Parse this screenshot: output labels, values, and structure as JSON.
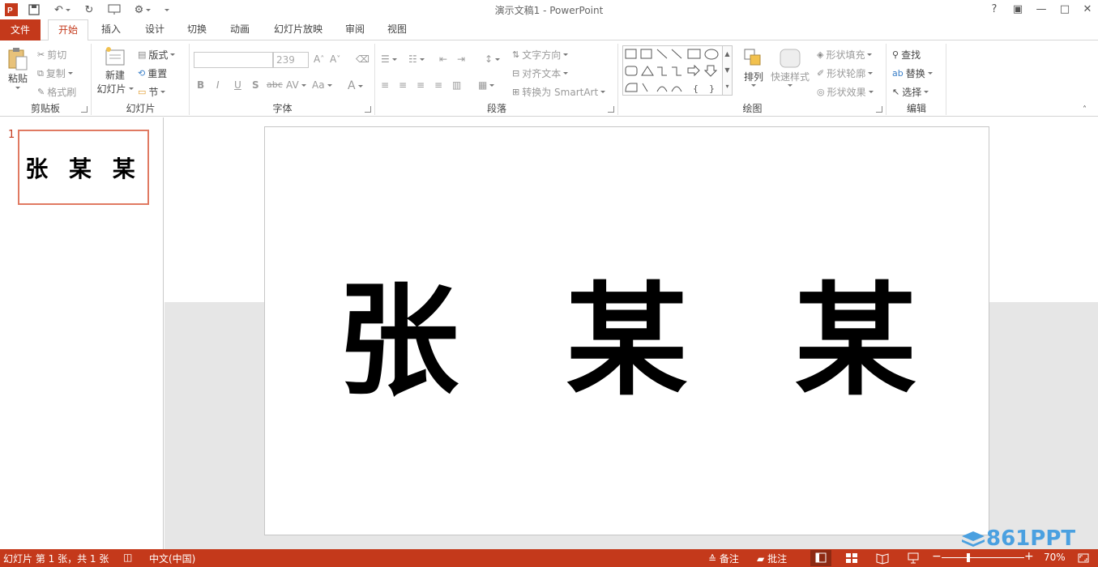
{
  "window": {
    "title": "演示文稿1 - PowerPoint",
    "help": "?",
    "minimize": "—",
    "restore": "□",
    "close": "✕"
  },
  "tabs": [
    {
      "label": "文件"
    },
    {
      "label": "开始"
    },
    {
      "label": "插入"
    },
    {
      "label": "设计"
    },
    {
      "label": "切换"
    },
    {
      "label": "动画"
    },
    {
      "label": "幻灯片放映"
    },
    {
      "label": "审阅"
    },
    {
      "label": "视图"
    }
  ],
  "ribbon": {
    "clipboard": {
      "label": "剪贴板",
      "paste": "粘贴",
      "cut": "剪切",
      "copy": "复制",
      "format_painter": "格式刷"
    },
    "slides": {
      "label": "幻灯片",
      "new_slide_line1": "新建",
      "new_slide_line2": "幻灯片",
      "layout": "版式",
      "reset": "重置",
      "section": "节"
    },
    "font": {
      "label": "字体",
      "font_name": "",
      "font_size": "239",
      "bold": "B",
      "italic": "I",
      "underline": "U",
      "shadow": "S",
      "strike": "abc",
      "spacing": "AV",
      "case": "Aa",
      "color": "A"
    },
    "paragraph": {
      "label": "段落",
      "text_direction": "文字方向",
      "align_text": "对齐文本",
      "smartart": "转换为 SmartArt"
    },
    "drawing": {
      "label": "绘图",
      "arrange": "排列",
      "quick_styles": "快速样式",
      "shape_fill": "形状填充",
      "shape_outline": "形状轮廓",
      "shape_effects": "形状效果"
    },
    "editing": {
      "label": "编辑",
      "find": "查找",
      "replace": "替换",
      "select": "选择"
    }
  },
  "thumbnails": [
    {
      "number": "1",
      "text": "张 某 某"
    }
  ],
  "slide": {
    "text": "张 某 某"
  },
  "statusbar": {
    "slide_info": "幻灯片 第 1 张，共 1 张",
    "language": "中文(中国)",
    "notes": "备注",
    "comments": "批注",
    "zoom": "70%"
  },
  "watermark": "861PPT",
  "colors": {
    "accent": "#c4391b",
    "thumb_border": "#e07a62"
  }
}
